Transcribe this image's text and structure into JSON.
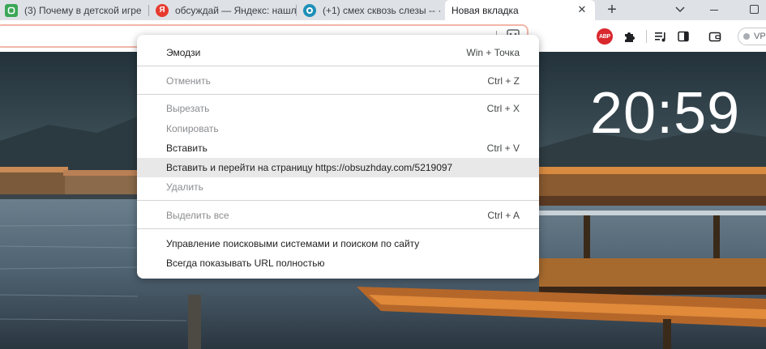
{
  "tabs": [
    {
      "title": "(3) Почему в детской игре",
      "favicon": "green-square-icon",
      "color": "#3aa757"
    },
    {
      "title": "обсуждай — Яндекс: нашл",
      "favicon": "yandex-icon",
      "color": "#e63b2e"
    },
    {
      "title": "(+1) смех сквозь слезы -- ·",
      "favicon": "ring-icon",
      "color": "#1e8fb8"
    },
    {
      "title": "Новая вкладка",
      "active": true
    }
  ],
  "toolbar": {
    "abp_label": "ABP",
    "vpn_label": "VPN"
  },
  "clock": "20:59",
  "menu": {
    "items": [
      {
        "label": "Эмодзи",
        "shortcut": "Win + Точка"
      },
      {
        "label": "Отменить",
        "shortcut": "Ctrl + Z",
        "disabled": true
      },
      {
        "label": "Вырезать",
        "shortcut": "Ctrl + X",
        "disabled": true
      },
      {
        "label": "Копировать",
        "shortcut": "",
        "disabled": true
      },
      {
        "label": "Вставить",
        "shortcut": "Ctrl + V"
      },
      {
        "label": "Вставить и перейти на страницу https://obsuzhday.com/5219097",
        "shortcut": "",
        "hover": true
      },
      {
        "label": "Удалить",
        "shortcut": "",
        "disabled": true
      },
      {
        "label": "Выделить все",
        "shortcut": "Ctrl + A",
        "disabled": true
      },
      {
        "label": "Управление поисковыми системами и поиском по сайту",
        "shortcut": ""
      },
      {
        "label": "Всегда показывать URL полностью",
        "shortcut": ""
      }
    ]
  },
  "colors": {
    "accent_border": "#f2b6a8",
    "abp_red": "#d9282e",
    "tabstrip": "#dee1e6"
  }
}
